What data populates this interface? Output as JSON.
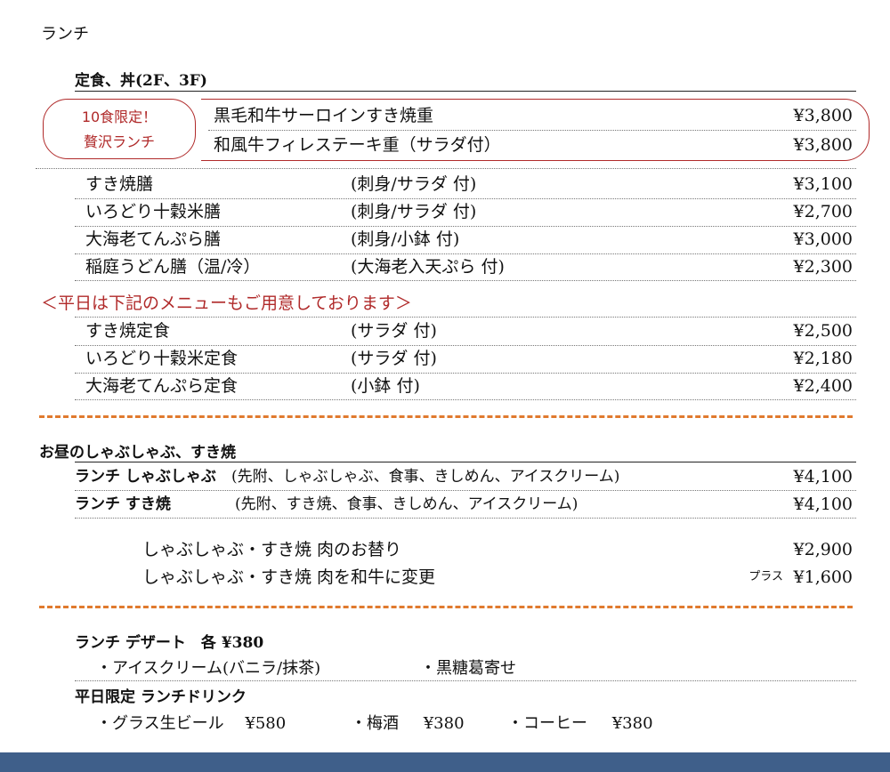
{
  "page_title": "ランチ",
  "teishoku": {
    "heading": "定食、丼(2F、3F)",
    "callout_line1": "10食限定！",
    "callout_line2": "贅沢ランチ",
    "limited_items": [
      {
        "name": "黒毛和牛サーロインすき焼重",
        "price": "¥3,800"
      },
      {
        "name": "和風牛フィレステーキ重（サラダ付）",
        "price": "¥3,800"
      }
    ],
    "items": [
      {
        "name": "すき焼膳",
        "note": "(刺身/サラダ 付)",
        "price": "¥3,100"
      },
      {
        "name": "いろどり十穀米膳",
        "note": "(刺身/サラダ 付)",
        "price": "¥2,700"
      },
      {
        "name": "大海老てんぷら膳",
        "note": "(刺身/小鉢 付)",
        "price": "¥3,000"
      },
      {
        "name": "稲庭うどん膳（温/冷）",
        "note": "(大海老入天ぷら 付)",
        "price": "¥2,300"
      }
    ],
    "weekday_notice": "＜平日は下記のメニューもご用意しております＞",
    "weekday_items": [
      {
        "name": "すき焼定食",
        "note": "(サラダ 付)",
        "price": "¥2,500"
      },
      {
        "name": "いろどり十穀米定食",
        "note": "(サラダ 付)",
        "price": "¥2,180"
      },
      {
        "name": "大海老てんぷら定食",
        "note": "(小鉢 付)",
        "price": "¥2,400"
      }
    ]
  },
  "shabu": {
    "heading": "お昼のしゃぶしゃぶ、すき焼",
    "items": [
      {
        "name": "ランチ しゃぶしゃぶ",
        "note": "(先附、しゃぶしゃぶ、食事、きしめん、アイスクリーム)",
        "price": "¥4,100"
      },
      {
        "name": "ランチ すき焼",
        "note": "(先附、すき焼、食事、きしめん、アイスクリーム)",
        "price": "¥4,100"
      }
    ],
    "options": [
      {
        "name": "しゃぶしゃぶ・すき焼 肉のお替り",
        "prefix": "",
        "price": "¥2,900"
      },
      {
        "name": "しゃぶしゃぶ・すき焼 肉を和牛に変更",
        "prefix": "プラス",
        "price": "¥1,600"
      }
    ]
  },
  "dessert": {
    "heading": "ランチ デザート　各 ¥380",
    "item1": "・アイスクリーム(バニラ/抹茶)",
    "item2": "・黒糖葛寄せ"
  },
  "drink": {
    "heading": "平日限定 ランチドリンク",
    "items": [
      {
        "name": "・グラス生ビール",
        "price": "¥580"
      },
      {
        "name": "・梅酒",
        "price": "¥380"
      },
      {
        "name": "・コーヒー",
        "price": "¥380"
      }
    ]
  },
  "colors": {
    "accent_red": "#b02a2a",
    "divider_orange": "#e07a2e",
    "footer_blue": "#3f5f8a"
  }
}
